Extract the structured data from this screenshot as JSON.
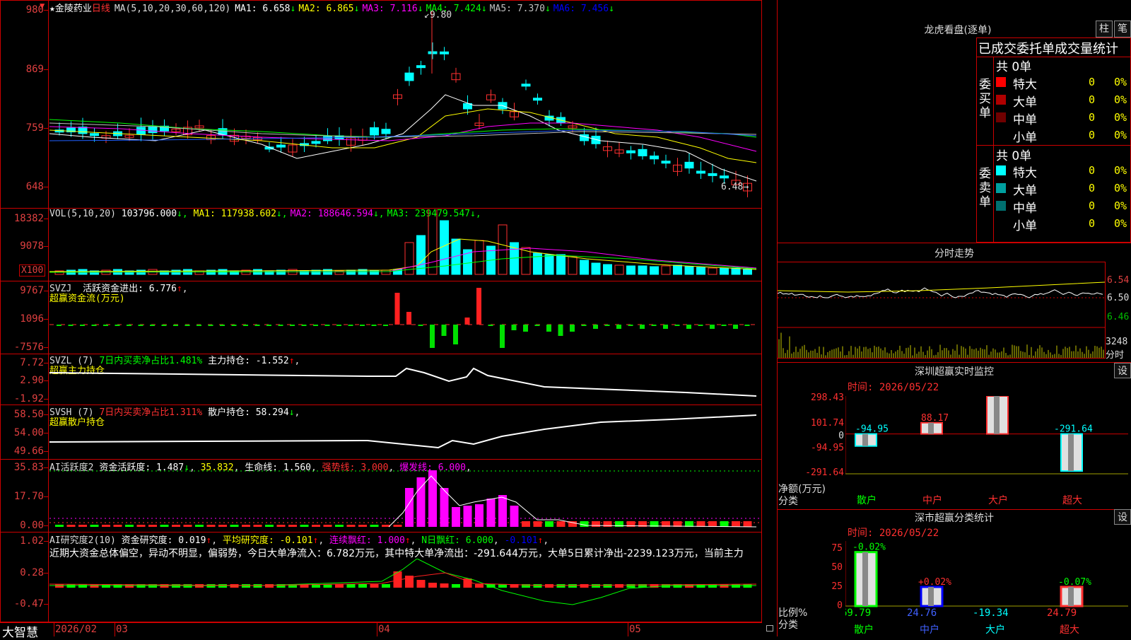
{
  "stock": {
    "name": "金陵药业",
    "period": "日线",
    "star": "★"
  },
  "main_panel": {
    "ma_label": "MA(5,10,20,30,60,120)",
    "ma": [
      {
        "label": "MA1:",
        "value": "6.658",
        "arrow": "↓",
        "color": "#ffffff"
      },
      {
        "label": "MA2:",
        "value": "6.865",
        "arrow": "↓",
        "color": "#ffff00"
      },
      {
        "label": "MA3:",
        "value": "7.116",
        "arrow": "↓",
        "color": "#ff00ff"
      },
      {
        "label": "MA4:",
        "value": "7.424",
        "arrow": "↓",
        "color": "#00ff00"
      },
      {
        "label": "MA5:",
        "value": "7.370",
        "arrow": "↓",
        "color": "#c0c0c0"
      },
      {
        "label": "MA6:",
        "value": "7.456",
        "arrow": "↓",
        "color": "#0000ff"
      }
    ],
    "yaxis": [
      "980",
      "869",
      "759",
      "648"
    ],
    "high_label": "9.80",
    "low_label": "6.48"
  },
  "vol_panel": {
    "label": "VOL(5,10,20)",
    "value": "103796.000",
    "ma": [
      {
        "label": "MA1:",
        "value": "117938.602",
        "arrow": "↓",
        "color": "#ffff00"
      },
      {
        "label": "MA2:",
        "value": "188646.594",
        "arrow": "↓",
        "color": "#ff00ff"
      },
      {
        "label": "MA3:",
        "value": "239479.547",
        "arrow": "↓",
        "color": "#00ff00"
      }
    ],
    "yaxis": [
      "18382",
      "9078"
    ],
    "unit": "X100"
  },
  "svzj_panel": {
    "name": "SVZJ",
    "text": "活跃资金进出:",
    "value": "6.776",
    "subtitle": "超赢资金流(万元)",
    "yaxis": [
      "9767",
      "1096",
      "-7576"
    ]
  },
  "svzl_panel": {
    "name": "SVZL (7)",
    "text1": "7日内买卖净占比1.481%",
    "text2": "主力持仓:",
    "value": "-1.552",
    "subtitle": "超赢主力持仓",
    "yaxis": [
      "7.72",
      "2.90",
      "-1.92"
    ]
  },
  "svsh_panel": {
    "name": "SVSH (7)",
    "text1": "7日内买卖净占比1.311%",
    "text2": "散户持仓:",
    "value": "58.294",
    "subtitle": "超赢散户持仓",
    "yaxis": [
      "58.50",
      "54.00",
      "49.66"
    ]
  },
  "ai_active_panel": {
    "name": "AI活跃度2",
    "t1": "资金活跃度:",
    "v1": "1.487",
    "v2": "35.832",
    "t3": "生命线:",
    "v3": "1.560",
    "t4": "强势线:",
    "v4": "3.000",
    "t5": "爆发线:",
    "v5": "6.000",
    "yaxis": [
      "35.83",
      "17.70",
      "0.00"
    ]
  },
  "ai_research_panel": {
    "name": "AI研究度2(10)",
    "t1": "资金研究度:",
    "v1": "0.019",
    "t2": "平均研究度:",
    "v2": "-0.101",
    "t3": "连续飘红:",
    "v3": "1.000",
    "t4": "N日飘红:",
    "v4": "6.000",
    "v5": "-0.101",
    "desc": "近期大资金总体偏空，异动不明显，偏弱势，今日大单净流入：6.782万元，其中特大单净流出：-291.644万元，大单5日累计净出-2239.123万元，当前主力",
    "yaxis": [
      "1.02",
      "0.28",
      "-0.47"
    ]
  },
  "bottom_bar": {
    "brand": "大智慧",
    "dates": [
      "2026/02",
      "03",
      "04",
      "05"
    ]
  },
  "right": {
    "lhb_title": "龙虎看盘(逐单)",
    "btn_zhu": "柱",
    "btn_bi": "笔",
    "stats_title": "已成交委托单成交量统计",
    "buy_group": "委买单",
    "sell_group": "委卖单",
    "buy_total": "共 0单",
    "sell_total": "共 0单",
    "buy_rows": [
      {
        "name": "特大",
        "n": "0",
        "p": "0%",
        "color": "#ff0000"
      },
      {
        "name": "大单",
        "n": "0",
        "p": "0%",
        "color": "#b00000"
      },
      {
        "name": "中单",
        "n": "0",
        "p": "0%",
        "color": "#700000"
      },
      {
        "name": "小单",
        "n": "0",
        "p": "0%",
        "color": "#000000"
      }
    ],
    "sell_rows": [
      {
        "name": "特大",
        "n": "0",
        "p": "0%",
        "color": "#00ffff"
      },
      {
        "name": "大单",
        "n": "0",
        "p": "0%",
        "color": "#00a0a0"
      },
      {
        "name": "中单",
        "n": "0",
        "p": "0%",
        "color": "#007070"
      },
      {
        "name": "小单",
        "n": "0",
        "p": "0%",
        "color": "#000000"
      }
    ],
    "fs_title": "分时走势",
    "fs_yaxis": [
      "6.54",
      "6.50",
      "6.46"
    ],
    "fs_vol": "3248",
    "fs_vol_unit": "分时",
    "sz_monitor_title": "深圳超赢实时监控",
    "sz_monitor_set": "设",
    "sz_monitor_time": "时间: 2026/05/22",
    "sz_monitor_yaxis": [
      "298.43",
      "101.74",
      "0",
      "-94.95",
      "-291.64"
    ],
    "sz_monitor_ylabel1": "净额(万元)",
    "sz_monitor_ylabel2": "分类",
    "sz_class_title": "深市超赢分类统计",
    "sz_class_set": "设",
    "sz_class_time": "时间: 2026/05/22",
    "sz_class_yaxis": [
      "75",
      "50",
      "25",
      "0"
    ],
    "sz_class_ylabel1": "比例%",
    "sz_class_ylabel2": "分类"
  },
  "chart_data": [
    {
      "type": "bar",
      "title": "深圳超赢实时监控",
      "categories": [
        "散户",
        "中户",
        "大户",
        "超大"
      ],
      "values": [
        -94.95,
        88.17,
        298.43,
        -291.64
      ],
      "ylim": [
        -291.64,
        298.43
      ]
    },
    {
      "type": "bar",
      "title": "深市超赢分类统计",
      "categories": [
        "散户",
        "中户",
        "大户",
        "超大"
      ],
      "values": [
        69.79,
        24.76,
        -19.34,
        24.79
      ],
      "changes": [
        "-0.02%",
        "+0.02%",
        "",
        "-0.07%"
      ],
      "ylim": [
        0,
        75
      ]
    }
  ]
}
